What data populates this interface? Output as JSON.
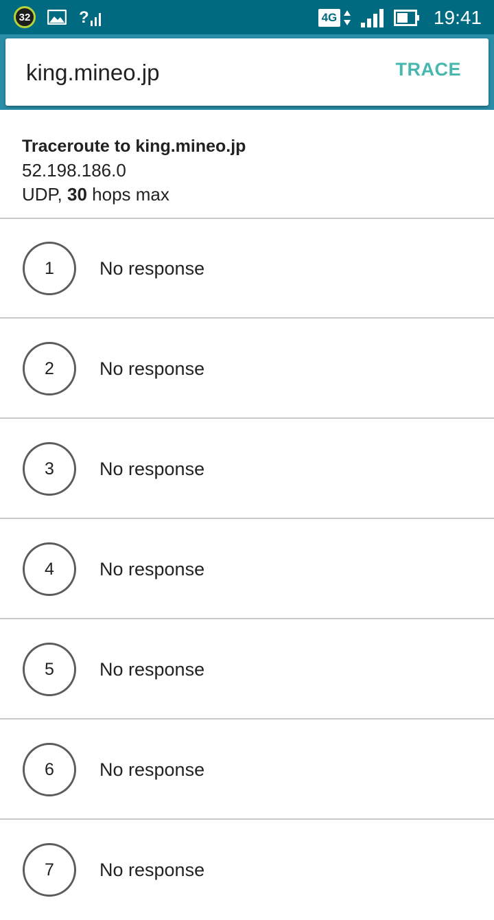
{
  "status_bar": {
    "badge": "32",
    "network_type": "4G",
    "time": "19:41",
    "icons": [
      "badge-icon",
      "gallery-icon",
      "wifi-unknown-icon",
      "4g-icon",
      "data-arrows-icon",
      "signal-icon",
      "battery-icon"
    ]
  },
  "search": {
    "host_value": "king.mineo.jp",
    "trace_label": "TRACE"
  },
  "summary": {
    "title": "Traceroute to king.mineo.jp",
    "ip": "52.198.186.0",
    "protocol_prefix": "UDP, ",
    "max_hops": "30",
    "protocol_suffix": " hops max"
  },
  "hops": [
    {
      "number": "1",
      "response": "No response"
    },
    {
      "number": "2",
      "response": "No response"
    },
    {
      "number": "3",
      "response": "No response"
    },
    {
      "number": "4",
      "response": "No response"
    },
    {
      "number": "5",
      "response": "No response"
    },
    {
      "number": "6",
      "response": "No response"
    },
    {
      "number": "7",
      "response": "No response"
    }
  ],
  "colors": {
    "status_bar": "#006a80",
    "accent": "#46b8ad"
  }
}
